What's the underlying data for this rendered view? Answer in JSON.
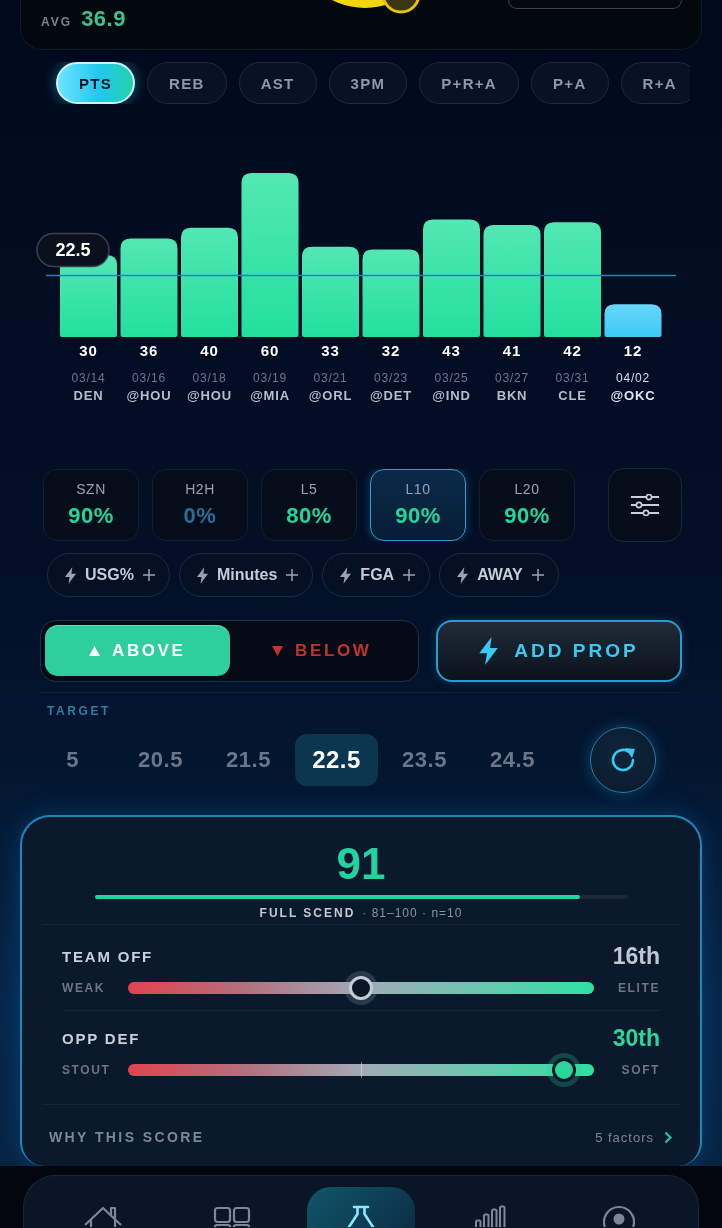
{
  "header": {
    "avg_label": "AVG",
    "avg_value": "36.9"
  },
  "stat_tabs": [
    {
      "label": "PTS",
      "selected": true
    },
    {
      "label": "REB",
      "selected": false
    },
    {
      "label": "AST",
      "selected": false
    },
    {
      "label": "3PM",
      "selected": false
    },
    {
      "label": "P+R+A",
      "selected": false
    },
    {
      "label": "P+A",
      "selected": false
    },
    {
      "label": "R+A",
      "selected": false
    }
  ],
  "chart": {
    "chart_data": {
      "type": "bar",
      "categories": [
        "03/14",
        "03/16",
        "03/18",
        "03/19",
        "03/21",
        "03/23",
        "03/25",
        "03/27",
        "03/31",
        "04/02"
      ],
      "series": [
        {
          "color": "#22e09e",
          "values": [
            30,
            36,
            40,
            60,
            33,
            32,
            43,
            41,
            42,
            null
          ]
        },
        {
          "color": "#3ccaf6",
          "values": [
            null,
            null,
            null,
            null,
            null,
            null,
            null,
            null,
            null,
            12
          ]
        }
      ],
      "ylim": [
        0,
        60
      ],
      "stacked": true,
      "data_labels": true,
      "ref_lines": [
        {
          "axis": "y",
          "value": 22.5,
          "label": "22.5"
        }
      ]
    },
    "opponents": [
      "DEN",
      "@HOU",
      "@HOU",
      "@MIA",
      "@ORL",
      "@DET",
      "@IND",
      "BKN",
      "CLE",
      "@OKC"
    ]
  },
  "splits": [
    {
      "label": "SZN",
      "value": "90%",
      "color": "#22d69a",
      "selected": false
    },
    {
      "label": "H2H",
      "value": "0%",
      "color": "#2a6c96",
      "selected": false
    },
    {
      "label": "L5",
      "value": "80%",
      "color": "#22d69a",
      "selected": false
    },
    {
      "label": "L10",
      "value": "90%",
      "color": "#22d69a",
      "selected": true
    },
    {
      "label": "L20",
      "value": "90%",
      "color": "#22d69a",
      "selected": false
    }
  ],
  "filters": [
    "USG%",
    "Minutes",
    "FGA",
    "AWAY"
  ],
  "direction": [
    {
      "kind": "above",
      "label": "ABOVE",
      "selected": true
    },
    {
      "kind": "below",
      "label": "BELOW",
      "selected": false
    }
  ],
  "add_prop": {
    "label": "ADD PROP"
  },
  "target": {
    "label": "TARGET",
    "options": [
      {
        "value": "5",
        "selected": false
      },
      {
        "value": "20.5",
        "selected": false
      },
      {
        "value": "21.5",
        "selected": false
      },
      {
        "value": "22.5",
        "selected": true
      },
      {
        "value": "23.5",
        "selected": false
      },
      {
        "value": "24.5",
        "selected": false
      }
    ]
  },
  "score": {
    "value": "91",
    "level": 0.91,
    "tier": "FULL SCEND",
    "meta": "· 81–100 · n=10",
    "factors": [
      {
        "name": "TEAM OFF",
        "rank": "16th",
        "low": "WEAK",
        "high": "ELITE",
        "level": 0.5,
        "highlighted": false
      },
      {
        "name": "OPP DEF",
        "rank": "30th",
        "low": "STOUT",
        "high": "SOFT",
        "level": 0.96,
        "highlighted": true
      }
    ],
    "why": {
      "label": "WHY THIS SCORE",
      "count": "5 factors"
    }
  },
  "nav": [
    {
      "kind": "home",
      "selected": false
    },
    {
      "kind": "grid",
      "selected": false
    },
    {
      "kind": "flask",
      "selected": true
    },
    {
      "kind": "bars",
      "selected": false
    },
    {
      "kind": "profile",
      "selected": false
    }
  ]
}
